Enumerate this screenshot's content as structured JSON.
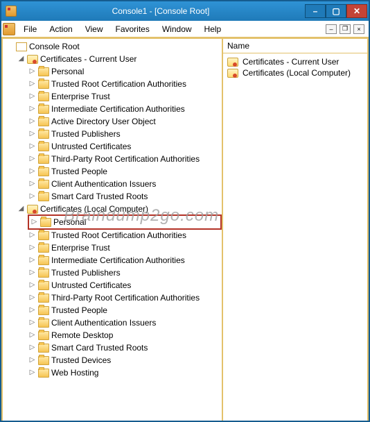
{
  "window": {
    "icon": "mmc",
    "title": "Console1 - [Console Root]"
  },
  "menu": {
    "items": [
      "File",
      "Action",
      "View",
      "Favorites",
      "Window",
      "Help"
    ]
  },
  "tree": {
    "root_label": "Console Root",
    "snapins": [
      {
        "label": "Certificates - Current User",
        "folders": [
          "Personal",
          "Trusted Root Certification Authorities",
          "Enterprise Trust",
          "Intermediate Certification Authorities",
          "Active Directory User Object",
          "Trusted Publishers",
          "Untrusted Certificates",
          "Third-Party Root Certification Authorities",
          "Trusted People",
          "Client Authentication Issuers",
          "Smart Card Trusted Roots"
        ],
        "highlighted_index": -1
      },
      {
        "label": "Certificates (Local Computer)",
        "folders": [
          "Personal",
          "Trusted Root Certification Authorities",
          "Enterprise Trust",
          "Intermediate Certification Authorities",
          "Trusted Publishers",
          "Untrusted Certificates",
          "Third-Party Root Certification Authorities",
          "Trusted People",
          "Client Authentication Issuers",
          "Remote Desktop",
          "Smart Card Trusted Roots",
          "Trusted Devices",
          "Web Hosting"
        ],
        "highlighted_index": 0
      }
    ]
  },
  "details": {
    "column": "Name",
    "items": [
      "Certificates - Current User",
      "Certificates (Local Computer)"
    ]
  },
  "watermark": "Braindump2go.com"
}
